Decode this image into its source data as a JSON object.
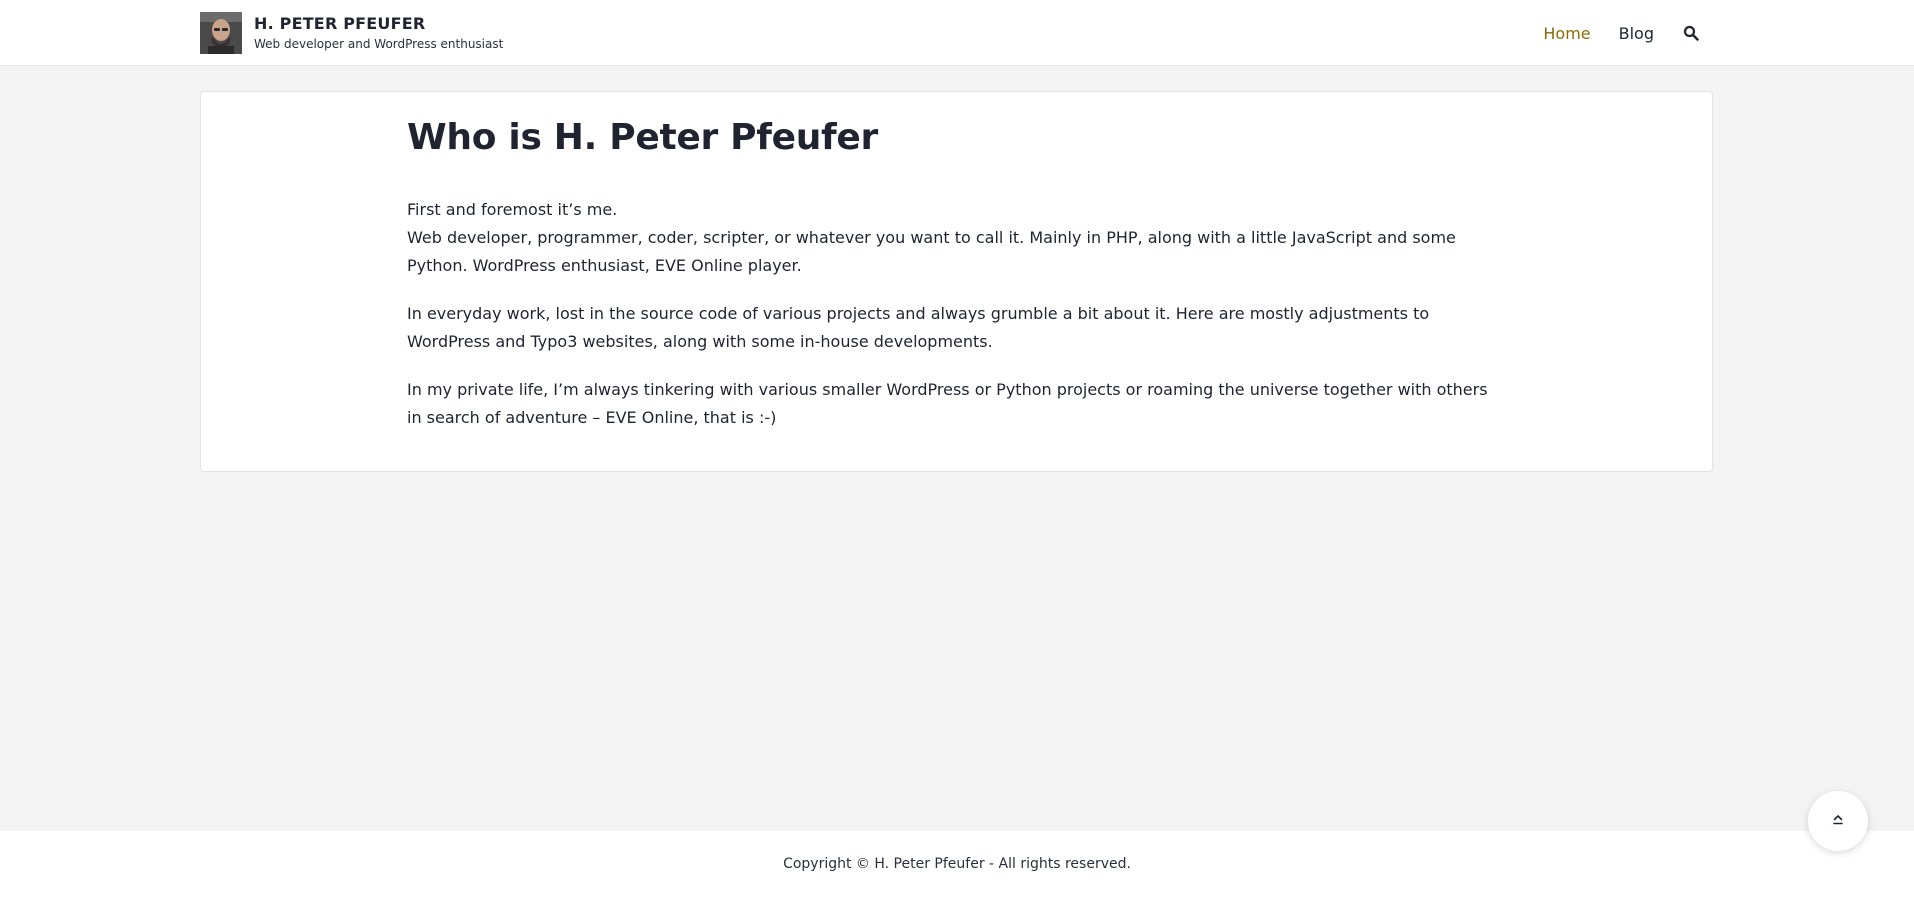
{
  "header": {
    "site_title": "H. PETER PFEUFER",
    "tagline": "Web developer and WordPress enthusiast",
    "nav": [
      {
        "label": "Home",
        "active": true
      },
      {
        "label": "Blog",
        "active": false
      }
    ],
    "search_icon": "search-icon"
  },
  "main": {
    "title": "Who is H. Peter Pfeufer",
    "paragraphs": [
      "First and foremost it’s me.",
      "Web developer, programmer, coder, scripter, or whatever you want to call it. Mainly in PHP, along with a little JavaScript and some Python. WordPress enthusiast, EVE Online player.",
      "In everyday work, lost in the source code of various projects and always grumble a bit about it. Here are mostly adjustments to WordPress and Typo3 websites, along with some in-house developments.",
      "In my private life, I’m always tinkering with various smaller WordPress or Python projects or roaming the universe together with others in search of adventure – EVE Online, that is :-)"
    ]
  },
  "footer": {
    "copyright": "Copyright © H. Peter Pfeufer - All rights reserved."
  },
  "back_to_top_icon": "chevron-up-icon",
  "colors": {
    "accent": "#8a6a07",
    "text": "#1f2430",
    "background": "#f3f3f3"
  }
}
